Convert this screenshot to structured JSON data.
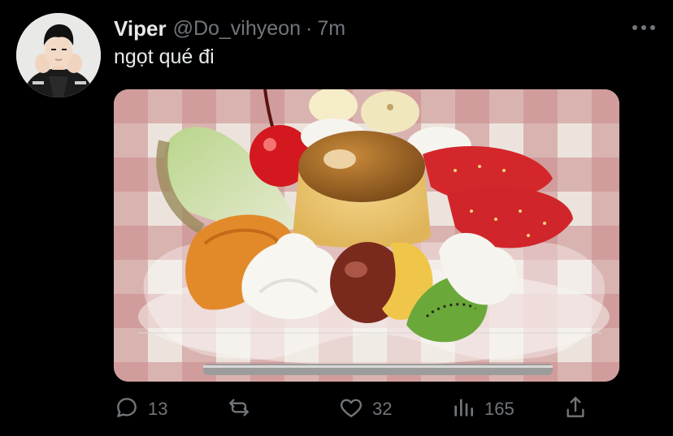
{
  "tweet": {
    "author_name": "Viper",
    "handle": "@Do_vihyeon",
    "separator": "·",
    "time": "7m",
    "text": "ngọt qué đi"
  },
  "actions": {
    "replies": "13",
    "likes": "32",
    "views": "165"
  },
  "icons": [
    "more-icon",
    "reply-icon",
    "retweet-icon",
    "like-icon",
    "views-icon",
    "share-icon"
  ],
  "colors": {
    "background": "#000000",
    "text_primary": "#e7e9ea",
    "text_secondary": "#71767b"
  }
}
